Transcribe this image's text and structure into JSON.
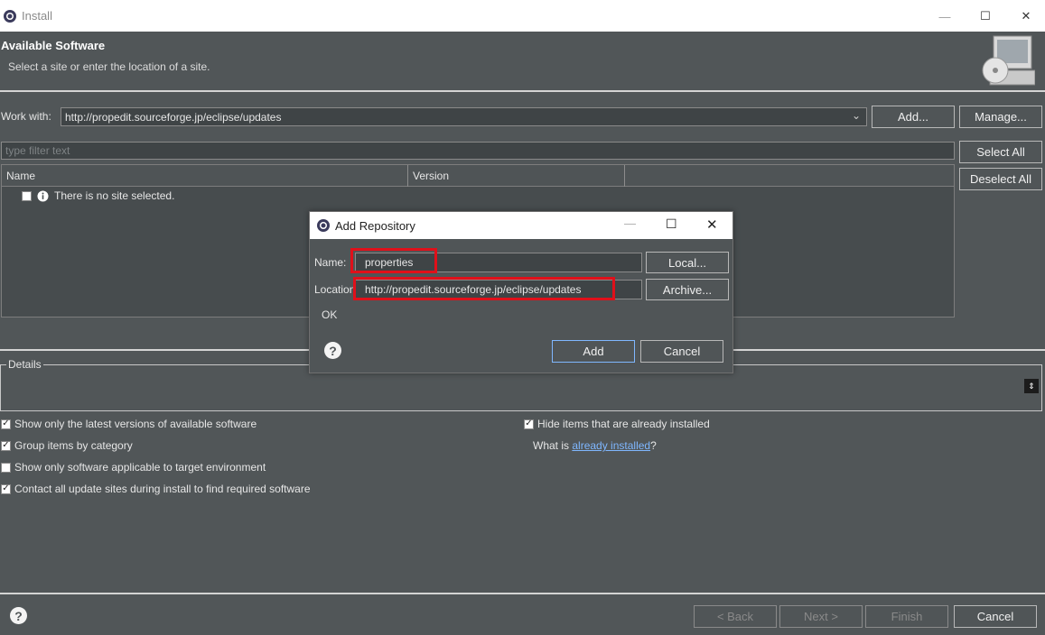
{
  "window": {
    "title": "Install",
    "controls": {
      "minimize": "—",
      "maximize": "☐",
      "close": "✕"
    }
  },
  "header": {
    "title": "Available Software",
    "subtitle": "Select a site or enter the location of a site."
  },
  "work_with": {
    "label": "Work with:",
    "value": "http://propedit.sourceforge.jp/eclipse/updates",
    "add_label": "Add...",
    "manage_label": "Manage..."
  },
  "filter": {
    "placeholder": "type filter text"
  },
  "side_buttons": {
    "select_all": "Select All",
    "deselect_all": "Deselect All"
  },
  "table": {
    "columns": [
      "Name",
      "Version"
    ],
    "rows": [
      {
        "text": "There is no site selected."
      }
    ]
  },
  "details": {
    "label": "Details"
  },
  "options_left": [
    {
      "label": "Show only the latest versions of available software",
      "checked": true
    },
    {
      "label": "Group items by category",
      "checked": true
    },
    {
      "label": "Show only software applicable to target environment",
      "checked": false
    },
    {
      "label": "Contact all update sites during install to find required software",
      "checked": true
    }
  ],
  "options_right": {
    "hide_installed": {
      "label": "Hide items that are already installed",
      "checked": true
    },
    "what_is_prefix": "What is",
    "what_is_link": "already installed",
    "what_is_suffix": "?"
  },
  "footer": {
    "back": "< Back",
    "next": "Next >",
    "finish": "Finish",
    "cancel": "Cancel"
  },
  "dialog": {
    "title": "Add Repository",
    "name_label": "Name:",
    "name_value": "properties",
    "location_label": "Location:",
    "location_value": "http://propedit.sourceforge.jp/eclipse/updates",
    "local_label": "Local...",
    "archive_label": "Archive...",
    "status": "OK",
    "add_label": "Add",
    "cancel_label": "Cancel"
  },
  "colors": {
    "highlight": "#e0101a",
    "link": "#7fb7ff"
  }
}
